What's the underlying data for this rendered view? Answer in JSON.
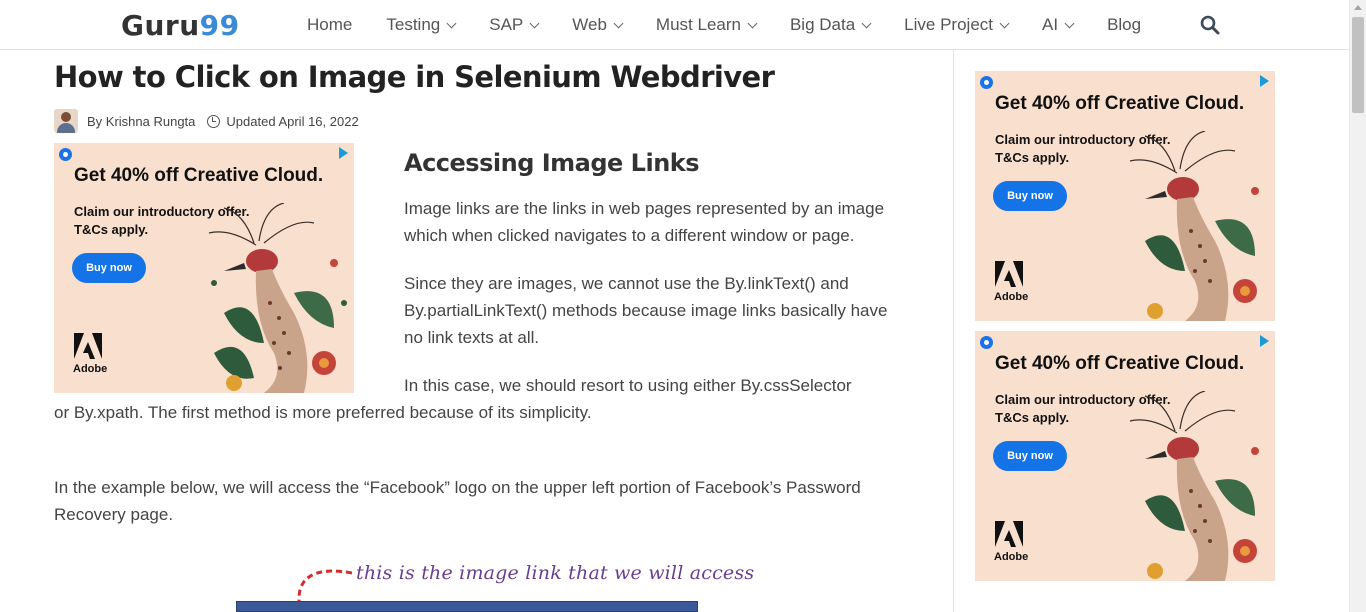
{
  "header": {
    "logo_primary": "Guru",
    "logo_accent": "99",
    "nav": [
      {
        "label": "Home",
        "dropdown": false
      },
      {
        "label": "Testing",
        "dropdown": true
      },
      {
        "label": "SAP",
        "dropdown": true
      },
      {
        "label": "Web",
        "dropdown": true
      },
      {
        "label": "Must Learn",
        "dropdown": true
      },
      {
        "label": "Big Data",
        "dropdown": true
      },
      {
        "label": "Live Project",
        "dropdown": true
      },
      {
        "label": "AI",
        "dropdown": true
      },
      {
        "label": "Blog",
        "dropdown": false
      }
    ],
    "search_icon": "search-icon"
  },
  "article": {
    "title": "How to Click on Image in Selenium Webdriver",
    "author": "By Krishna Rungta",
    "updated": "Updated April 16, 2022",
    "section_heading": "Accessing Image Links",
    "paragraphs": [
      "Image links are the links in web pages represented by an image which when clicked navigates to a different window or page.",
      "Since they are images, we cannot use the By.linkText() and By.partialLinkText() methods because image links basically have no link texts at all.",
      "In this case, we should resort to using either By.cssSelector or By.xpath. The first method is more preferred because of its simplicity.",
      "In the example below, we will access the “Facebook” logo on the upper left portion of Facebook’s Password Recovery page."
    ],
    "annotation": "this is the image link that we will access"
  },
  "ads": [
    {
      "headline": "Get 40% off Creative Cloud.",
      "line1": "Claim our introductory offer.",
      "line2": "T&Cs apply.",
      "button": "Buy now",
      "brand": "Adobe"
    },
    {
      "headline": "Get 40% off Creative Cloud.",
      "line1": "Claim our introductory offer.",
      "line2": "T&Cs apply.",
      "button": "Buy now",
      "brand": "Adobe"
    },
    {
      "headline": "Get 40% off Creative Cloud.",
      "line1": "Claim our introductory offer.",
      "line2": "T&Cs apply.",
      "button": "Buy now",
      "brand": "Adobe"
    }
  ],
  "colors": {
    "brand_accent": "#3a8ad6",
    "ad_background": "#f9dfcd",
    "ad_button": "#1473e6",
    "annotation": "#6a3d8f"
  }
}
